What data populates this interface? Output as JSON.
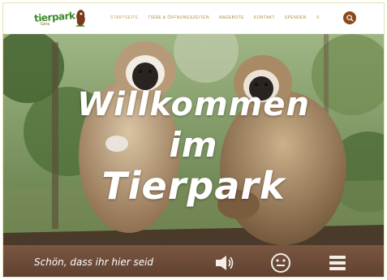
{
  "header": {
    "logo_text": "tierpark",
    "logo_sub": "Gera",
    "nav": [
      {
        "label": "Startseite",
        "active": true
      },
      {
        "label": "Tiere & Öffnungszeiten",
        "active": false
      },
      {
        "label": "Angebote",
        "active": false
      },
      {
        "label": "Kontakt",
        "active": false
      },
      {
        "label": "Spenden",
        "active": false
      }
    ],
    "nav_more": "≡"
  },
  "hero": {
    "line1": "Willkommen",
    "line2": "im",
    "line3": "Tierpark"
  },
  "bottom": {
    "tagline": "Schön, dass ihr hier seid",
    "icons": [
      "speaker-icon",
      "smiley-icon",
      "menu-stack-icon"
    ]
  },
  "colors": {
    "brand_green": "#3d8a2a",
    "nav_gold": "#b08a3a",
    "search_brown": "#8a4a1e",
    "bar_brown": "#6b4a36"
  }
}
